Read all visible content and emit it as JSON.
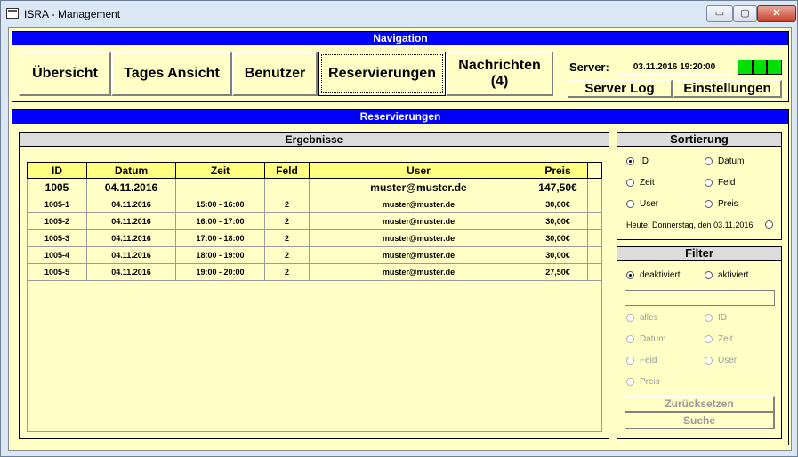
{
  "window": {
    "title": "ISRA - Management",
    "min_glyph": "▭",
    "max_glyph": "▢",
    "close_glyph": "✕"
  },
  "navigation": {
    "title": "Navigation",
    "buttons": [
      "Übersicht",
      "Tages Ansicht",
      "Benutzer",
      "Reservierungen",
      "Nachrichten\n(4)"
    ],
    "server_label": "Server:",
    "server_time": "03.11.2016 19:20:00",
    "status_color": "#00e000",
    "server_log": "Server Log",
    "settings": "Einstellungen"
  },
  "reservations": {
    "title": "Reservierungen",
    "results_title": "Ergebnisse",
    "columns": [
      "ID",
      "Datum",
      "Zeit",
      "Feld",
      "User",
      "Preis"
    ],
    "main_row": [
      "1005",
      "04.11.2016",
      "",
      "",
      "muster@muster.de",
      "147,50€"
    ],
    "rows": [
      [
        "1005-1",
        "04.11.2016",
        "15:00 - 16:00",
        "2",
        "muster@muster.de",
        "30,00€"
      ],
      [
        "1005-2",
        "04.11.2016",
        "16:00 - 17:00",
        "2",
        "muster@muster.de",
        "30,00€"
      ],
      [
        "1005-3",
        "04.11.2016",
        "17:00 - 18:00",
        "2",
        "muster@muster.de",
        "30,00€"
      ],
      [
        "1005-4",
        "04.11.2016",
        "18:00 - 19:00",
        "2",
        "muster@muster.de",
        "30,00€"
      ],
      [
        "1005-5",
        "04.11.2016",
        "19:00 - 20:00",
        "2",
        "muster@muster.de",
        "27,50€"
      ]
    ]
  },
  "sorting": {
    "title": "Sortierung",
    "options": [
      "ID",
      "Datum",
      "Zeit",
      "Feld",
      "User",
      "Preis"
    ],
    "selected": "ID",
    "today": "Heute: Donnerstag, den 03.11.2016"
  },
  "filter": {
    "title": "Filter",
    "mode_off": "deaktiviert",
    "mode_on": "aktiviert",
    "input_value": "",
    "fields": [
      "alles",
      "ID",
      "Datum",
      "Zeit",
      "Feld",
      "User",
      "Preis"
    ],
    "reset": "Zurücksetzen",
    "search": "Suche"
  }
}
